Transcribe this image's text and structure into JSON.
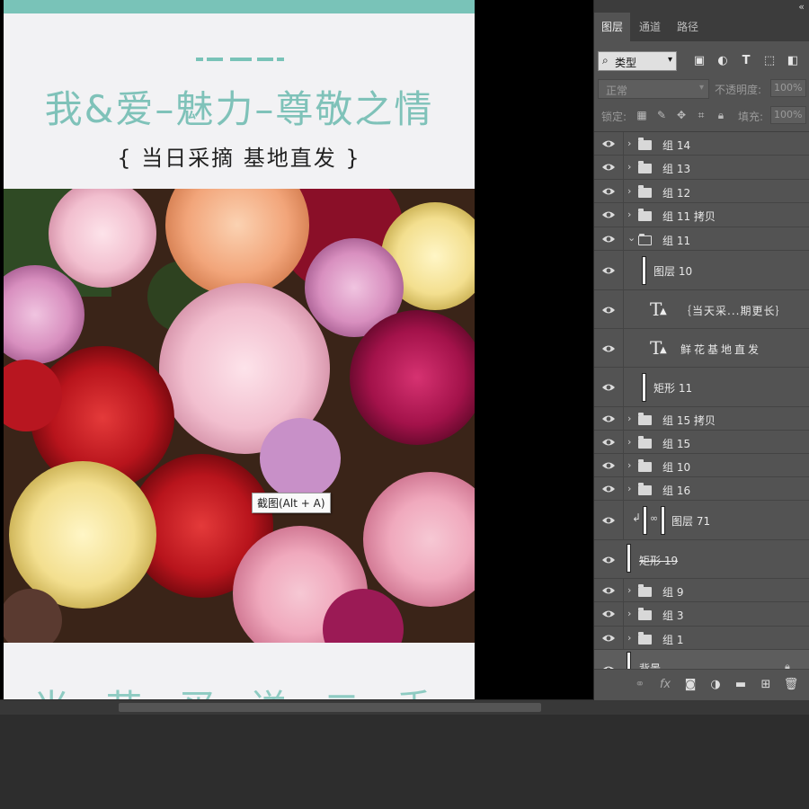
{
  "document": {
    "title": "我&爱–魅力–尊敬之情",
    "subtitle": "{ 当日采摘  基地直发 }",
    "bottom_text": "当 节 买 送 二 手 摘 法"
  },
  "tooltip": "截图(Alt + A)",
  "panel": {
    "collapse_icon": "«",
    "tabs": [
      "图层",
      "通道",
      "路径"
    ],
    "filter": {
      "label": "类型",
      "icon": "search-icon"
    },
    "blend_mode": "正常",
    "opacity_label": "不透明度:",
    "opacity_value": "100%",
    "lock_label": "锁定:",
    "fill_label": "填充:",
    "fill_value": "100%",
    "layers": [
      {
        "name": "组 14",
        "type": "group"
      },
      {
        "name": "组 13",
        "type": "group"
      },
      {
        "name": "组 12",
        "type": "group"
      },
      {
        "name": "组 11 拷贝",
        "type": "group"
      },
      {
        "name": "组 11",
        "type": "group-open"
      },
      {
        "name": "图层 10",
        "type": "layer"
      },
      {
        "name": "｛当天采...期更长｝",
        "type": "text"
      },
      {
        "name": "鲜花基地直发",
        "type": "text"
      },
      {
        "name": "矩形 11",
        "type": "shape"
      },
      {
        "name": "组 15 拷贝",
        "type": "group"
      },
      {
        "name": "组 15",
        "type": "group"
      },
      {
        "name": "组 10",
        "type": "group"
      },
      {
        "name": "组 16",
        "type": "group"
      },
      {
        "name": "图层 71",
        "type": "clipped"
      },
      {
        "name": "矩形 19",
        "type": "shape-hidden"
      },
      {
        "name": "组 9",
        "type": "group"
      },
      {
        "name": "组 3",
        "type": "group"
      },
      {
        "name": "组 1",
        "type": "group"
      },
      {
        "name": "背景",
        "type": "background"
      }
    ]
  },
  "colors": {
    "accent": "#79c3b8",
    "panel": "#535353"
  }
}
